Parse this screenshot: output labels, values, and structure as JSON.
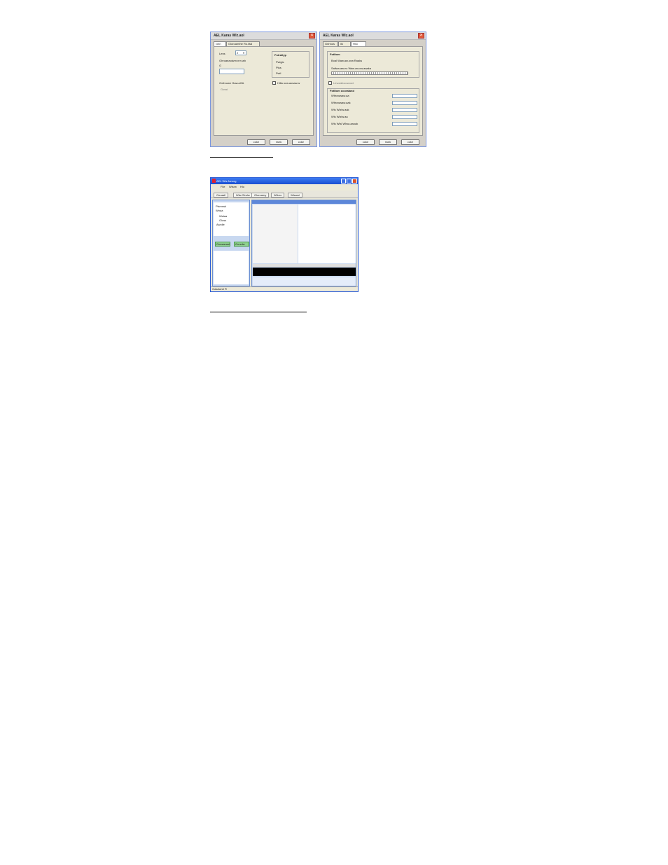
{
  "left_dialog": {
    "title": "AEL Karas Wlz.aol",
    "tabs": [
      "Gen",
      "Gloroamthe Ro.iltal"
    ],
    "size_label": "Lens",
    "size_value": "2",
    "lines_label": "Ghroaeaoiwm.nrr.ssh",
    "lines_sub": "G",
    "group_title": "Fotraltyp",
    "radio_options": [
      "Pwigis",
      "Plus",
      "Pwil"
    ],
    "bottom_left_label": "Gvthrowe Gaw.aGA",
    "bottom_sub": "Gossi",
    "checkbox_label": "Hilla ocw.aosaw.w",
    "buttons": [
      "coke",
      "rwek",
      "ccke"
    ]
  },
  "right_dialog": {
    "title": "AEL Karas Wlz.aol",
    "tabs": [
      "Grinnos",
      "ilk",
      "Hnc"
    ],
    "group1_title": "Fotltom",
    "group1_line1": "Boal Waw.aw.ovw.Raaks",
    "group1_line2": "Sallwa.aw.eo Waw.aw.ow.aaaka",
    "checkbox_label": "Llrwzallocowowt",
    "group2_title": "Fotltom ocoraland",
    "rows": [
      "Wltrowwaw.aa",
      "Wltrowwaw.aak",
      "Wls Wlzlw.aak",
      "Wls Wlzlw.aa",
      "Wls Wlsl Wlwa.aaoak"
    ],
    "buttons": [
      "coke",
      "rwek",
      "ccke"
    ]
  },
  "caption1": "",
  "app_window": {
    "title": "AEL Wls.Jaroog",
    "menu": [
      "Flle",
      "Wlsrw",
      "Hlo"
    ],
    "toolbar": [
      "Gw.aall",
      "Wlw.Glrolw",
      "Gloroamy",
      "Wlloro",
      "Wlsaml"
    ],
    "tree": [
      "Plsrrwsk",
      "Wnaa",
      "Walaa",
      "Gloss",
      "Awolle"
    ],
    "green_buttons": [
      "Gossanaol",
      "Gonolw"
    ],
    "status": "Gasawrol R"
  },
  "caption2": ""
}
